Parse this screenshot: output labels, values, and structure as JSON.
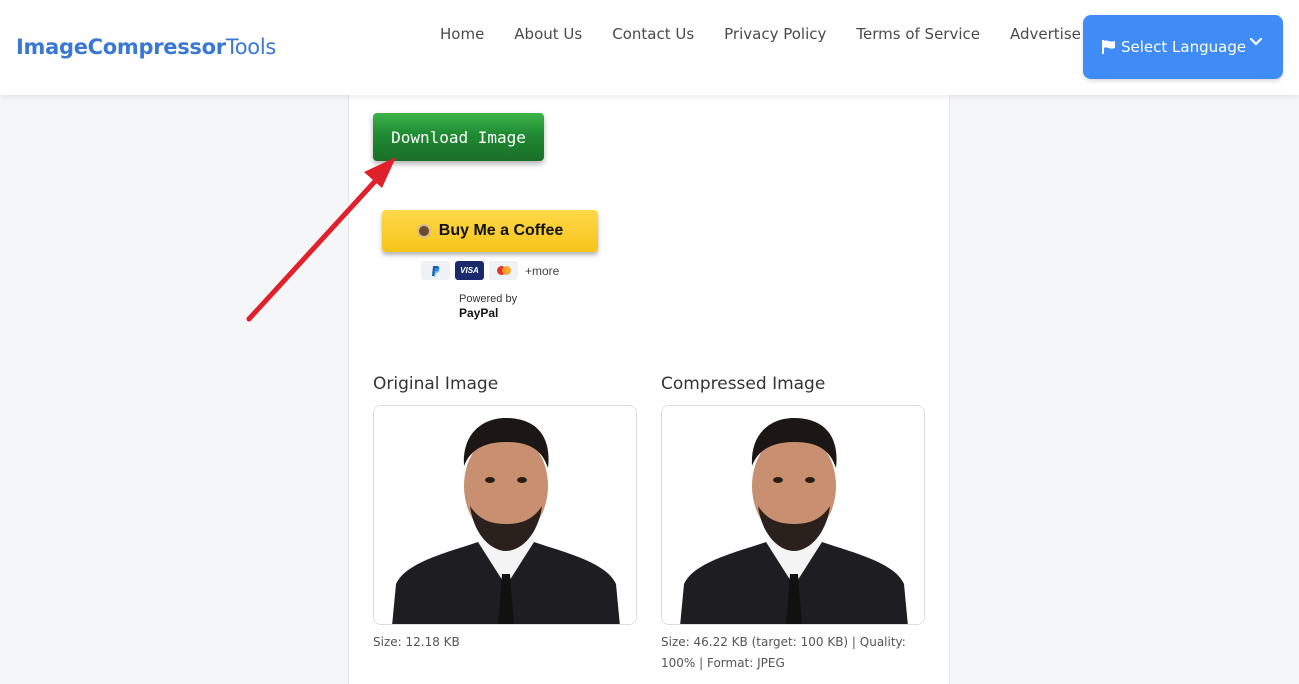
{
  "header": {
    "logo_bold": "ImageCompressor",
    "logo_light": "Tools",
    "nav": [
      "Home",
      "About Us",
      "Contact Us",
      "Privacy Policy",
      "Terms of Service",
      "Advertise W"
    ],
    "language_label": "Select Language"
  },
  "actions": {
    "download_label": "Download Image",
    "coffee_label": "Buy Me a Coffee",
    "payment_methods": [
      "PayPal",
      "VISA",
      "Mastercard"
    ],
    "visa_text": "VISA",
    "more_label": "+more",
    "powered_by": "Powered by",
    "paypal_name": "PayPal"
  },
  "results": {
    "original": {
      "title": "Original Image",
      "size_text": "Size: 12.18 KB"
    },
    "compressed": {
      "title": "Compressed Image",
      "size_line1": "Size: 46.22 KB (target: 100 KB) | Quality:",
      "size_line2": "100% | Format: JPEG"
    }
  },
  "colors": {
    "brand": "#3a78d4",
    "language_button": "#3f8cf7",
    "download_button": "#1f8a32",
    "coffee_button": "#f5c518",
    "annotation_arrow": "#e0202a"
  }
}
